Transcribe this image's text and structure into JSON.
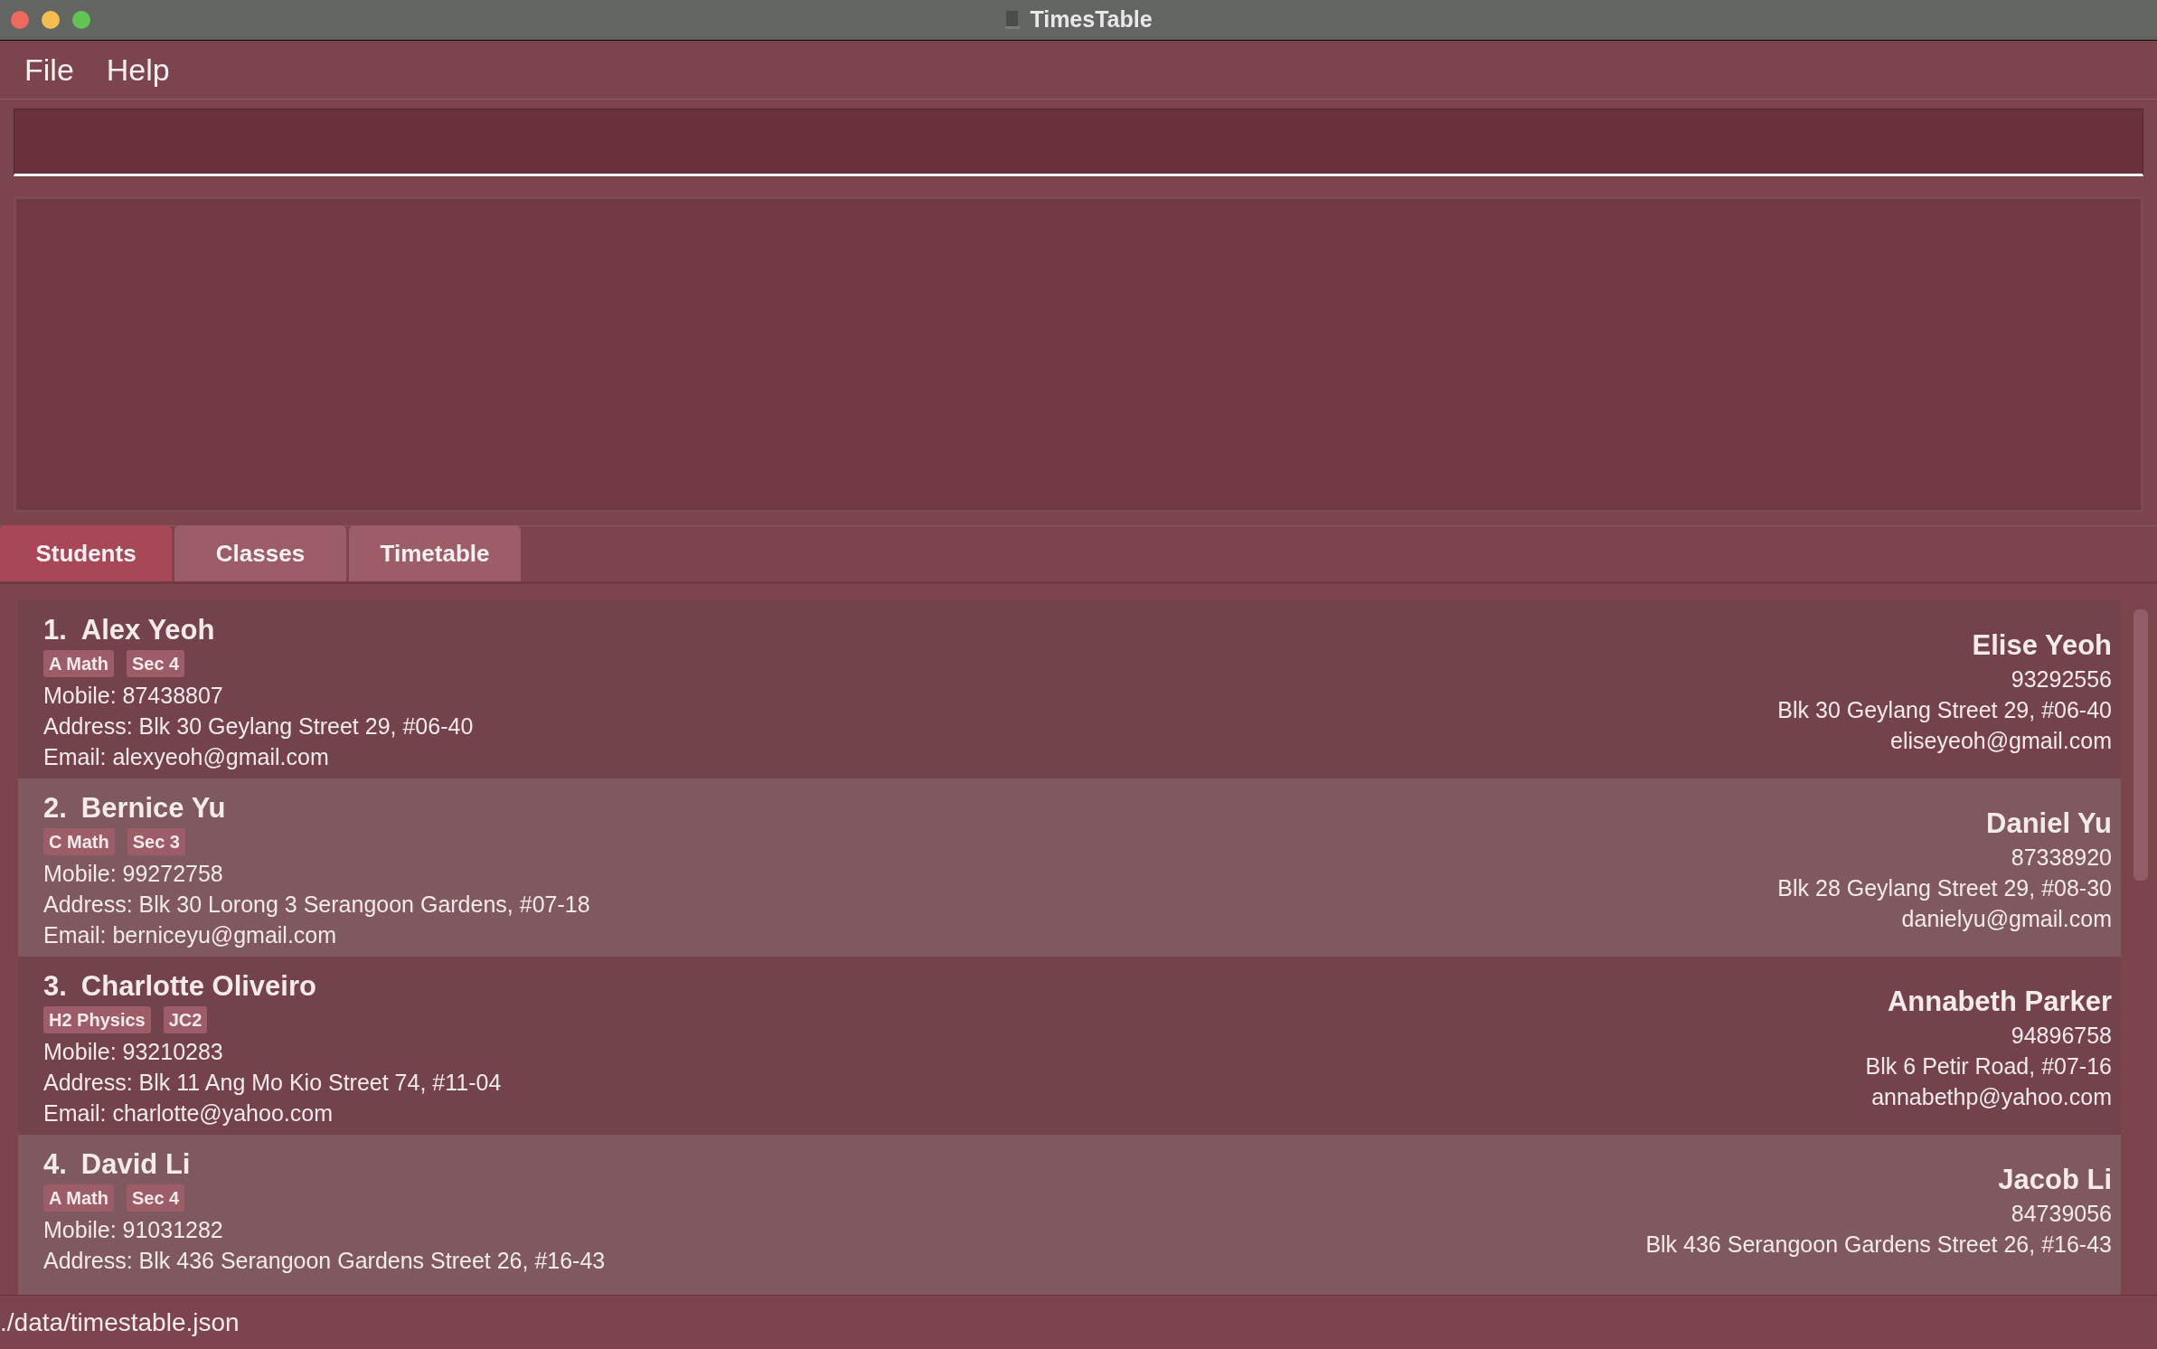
{
  "window": {
    "title": "TimesTable"
  },
  "menu": [
    "File",
    "Help"
  ],
  "tabs": [
    {
      "label": "Students",
      "selected": true
    },
    {
      "label": "Classes",
      "selected": false
    },
    {
      "label": "Timetable",
      "selected": false
    }
  ],
  "students": [
    {
      "index": "1.",
      "name": "Alex Yeoh",
      "tags": [
        "A Math",
        "Sec 4"
      ],
      "mobile": "Mobile: 87438807",
      "address": "Address: Blk 30 Geylang Street 29, #06-40",
      "email": "Email: alexyeoh@gmail.com",
      "parent": {
        "name": "Elise Yeoh",
        "phone": "93292556",
        "address": "Blk 30 Geylang Street 29, #06-40",
        "email": "eliseyeoh@gmail.com"
      }
    },
    {
      "index": "2.",
      "name": "Bernice Yu",
      "tags": [
        "C Math",
        "Sec 3"
      ],
      "mobile": "Mobile: 99272758",
      "address": "Address: Blk 30 Lorong 3 Serangoon Gardens, #07-18",
      "email": "Email: berniceyu@gmail.com",
      "parent": {
        "name": "Daniel Yu",
        "phone": "87338920",
        "address": "Blk 28 Geylang Street 29, #08-30",
        "email": "danielyu@gmail.com"
      }
    },
    {
      "index": "3.",
      "name": "Charlotte Oliveiro",
      "tags": [
        "H2 Physics",
        "JC2"
      ],
      "mobile": "Mobile: 93210283",
      "address": "Address: Blk 11 Ang Mo Kio Street 74, #11-04",
      "email": "Email: charlotte@yahoo.com",
      "parent": {
        "name": "Annabeth Parker",
        "phone": "94896758",
        "address": "Blk 6 Petir Road, #07-16",
        "email": "annabethp@yahoo.com"
      }
    },
    {
      "index": "4.",
      "name": "David Li",
      "tags": [
        "A Math",
        "Sec 4"
      ],
      "mobile": "Mobile: 91031282",
      "address": "Address: Blk 436 Serangoon Gardens Street 26, #16-43",
      "parent": {
        "name": "Jacob Li",
        "phone": "84739056",
        "address": "Blk 436 Serangoon Gardens Street 26, #16-43"
      }
    }
  ],
  "status_bar": "./data/timestable.json"
}
